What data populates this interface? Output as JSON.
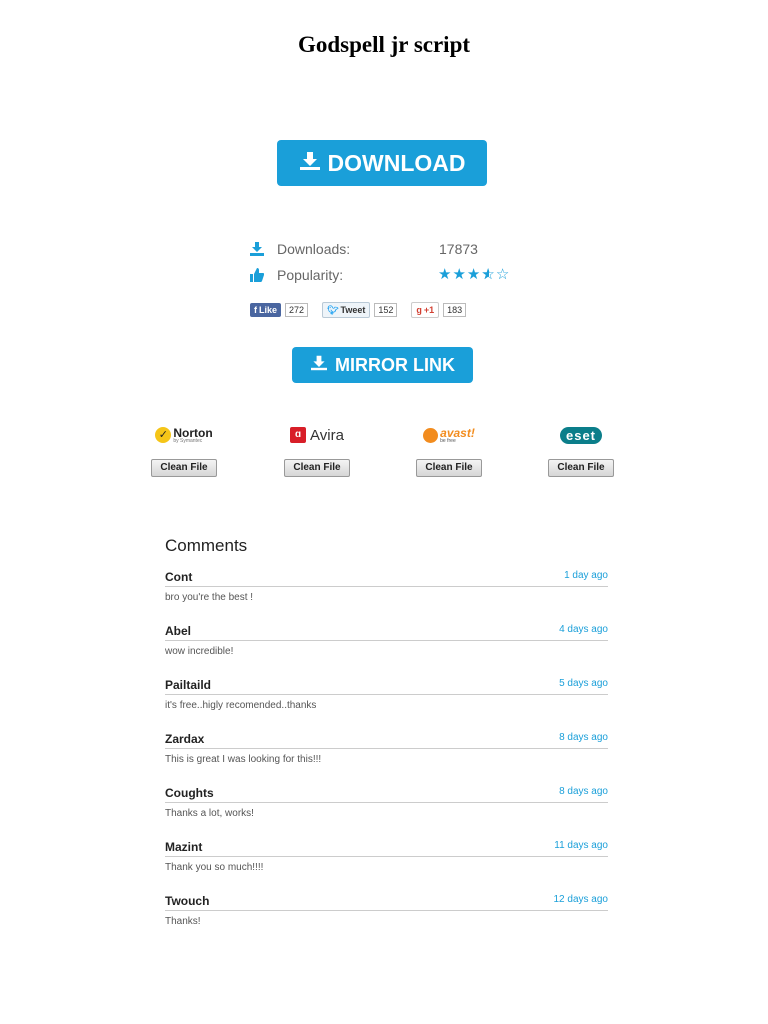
{
  "page": {
    "title": "Godspell jr script"
  },
  "download_button": {
    "label": "DOWNLOAD"
  },
  "stats": {
    "downloads_label": "Downloads:",
    "downloads_value": "17873",
    "popularity_label": "Popularity:",
    "popularity_stars": 3.5,
    "popularity_max": 5
  },
  "social": {
    "facebook": {
      "label": "Like",
      "count": "272"
    },
    "twitter": {
      "label": "Tweet",
      "count": "152"
    },
    "google": {
      "label": "+1",
      "count": "183"
    }
  },
  "mirror_button": {
    "label": "MIRROR LINK"
  },
  "antivirus": [
    {
      "name": "Norton",
      "sub": "by Symantec",
      "button": "Clean File",
      "color": "#222222"
    },
    {
      "name": "Avira",
      "button": "Clean File",
      "color": "#d81e28"
    },
    {
      "name": "avast!",
      "sub": "be free",
      "button": "Clean File",
      "color": "#f28c1e"
    },
    {
      "name": "eset",
      "button": "Clean File",
      "color": "#0b7e8a"
    }
  ],
  "comments": {
    "title": "Comments",
    "items": [
      {
        "author": "Cont",
        "date": "1 day ago",
        "text": "bro you're the best !"
      },
      {
        "author": "Abel",
        "date": "4 days ago",
        "text": "wow incredible!"
      },
      {
        "author": "Pailtaild",
        "date": "5 days ago",
        "text": "it's free..higly recomended..thanks"
      },
      {
        "author": "Zardax",
        "date": "8 days ago",
        "text": "This is great I was looking for this!!!"
      },
      {
        "author": "Coughts",
        "date": "8 days ago",
        "text": "Thanks a lot, works!"
      },
      {
        "author": "Mazint",
        "date": "11 days ago",
        "text": "Thank you so much!!!!"
      },
      {
        "author": "Twouch",
        "date": "12 days ago",
        "text": "Thanks!"
      }
    ]
  },
  "colors": {
    "accent": "#1a9fd9",
    "facebook": "#4a66a0"
  }
}
